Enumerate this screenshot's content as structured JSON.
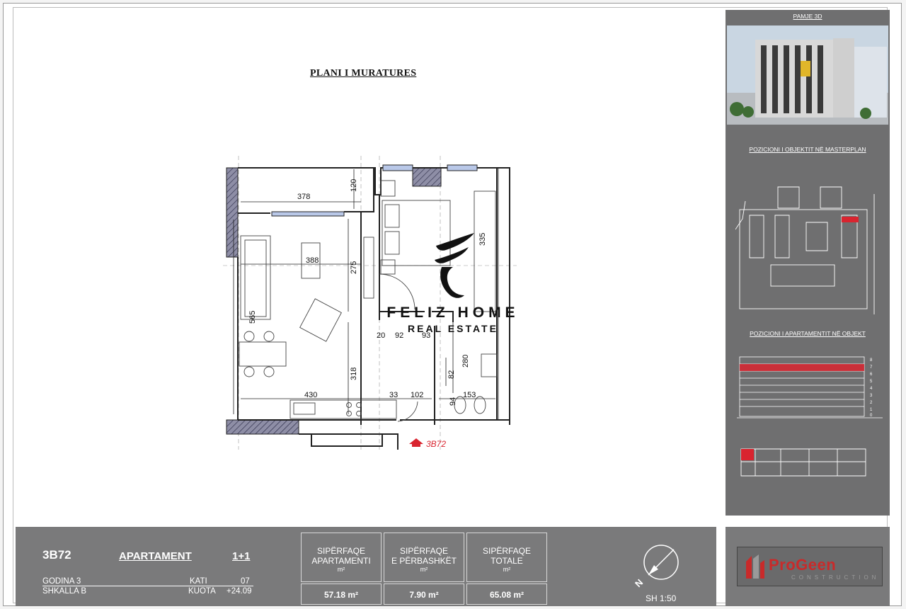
{
  "plan": {
    "title": "PLANI I MURATURES",
    "dims": {
      "d378": "378",
      "d120": "120",
      "d388": "388",
      "d275": "275",
      "d565": "565",
      "d318": "318",
      "d430": "430",
      "d33": "33",
      "d102": "102",
      "d153": "153",
      "d20": "20",
      "d92": "92",
      "d93": "93",
      "d82": "82",
      "d280": "280",
      "d94": "94",
      "d335": "335"
    },
    "unit_marker": "3B72"
  },
  "watermark": {
    "name": "FELIZ HOME",
    "sub": "REAL ESTATE"
  },
  "side": {
    "pamje_label": "PAMJE 3D",
    "masterplan_label": "POZICIONI I OBJEKTIT NË MASTERPLAN",
    "apartment_position_label": "POZICIONI I APARTAMENTIT NË OBJEKT",
    "floor_numbers": [
      "8",
      "7",
      "6",
      "5",
      "4",
      "3",
      "2",
      "1",
      "0"
    ],
    "highlight_color": "#d9242f"
  },
  "footer": {
    "unit_code": "3B72",
    "type_label": "APARTAMENT",
    "type_value": "1+1",
    "building_label": "GODINA 3",
    "floor_label": "KATI",
    "floor_value": "07",
    "staircase_label": "SHKALLA B",
    "level_label": "KUOTA",
    "level_value": "+24.09",
    "areas": [
      {
        "l1": "SIPËRFAQE",
        "l2": "APARTAMENTI",
        "unit": "m²",
        "value": "57.18 m²"
      },
      {
        "l1": "SIPËRFAQE",
        "l2": "E PËRBASHKËT",
        "unit": "m²",
        "value": "7.90 m²"
      },
      {
        "l1": "SIPËRFAQE",
        "l2": "TOTALE",
        "unit": "m²",
        "value": "65.08 m²"
      }
    ],
    "north_letter": "N",
    "scale": "SH 1:50",
    "logo_main": "ProGeen",
    "logo_sub": "CONSTRUCTION"
  }
}
